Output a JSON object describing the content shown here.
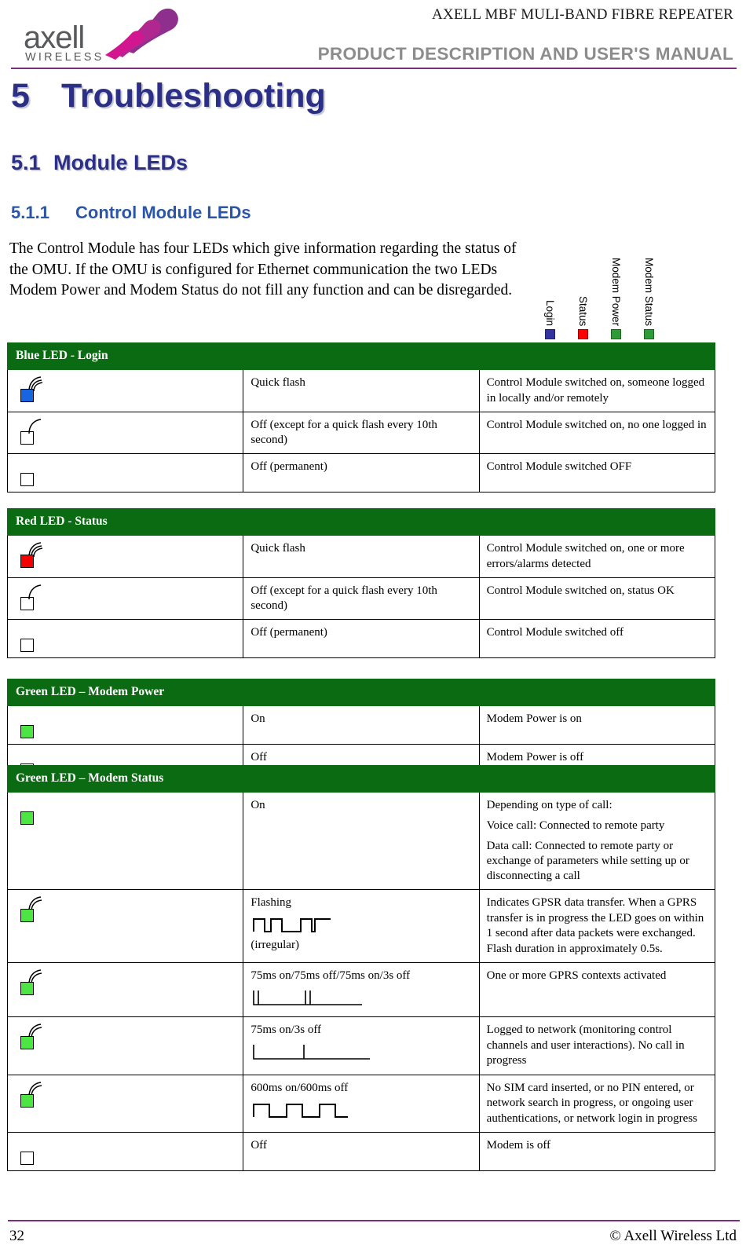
{
  "header": {
    "line1": "AXELL MBF MULI-BAND FIBRE REPEATER",
    "line2": "PRODUCT DESCRIPTION AND USER'S MANUAL",
    "logo_word": "axell",
    "logo_sub": "WIRELESS",
    "rule_color": "#7b2d7e"
  },
  "headings": {
    "h1_number": "5",
    "h1_text": "Troubleshooting",
    "h2_number": "5.1",
    "h2_text": "Module LEDs",
    "h3_number": "5.1.1",
    "h3_text": "Control Module LEDs",
    "h1_color": "#2b2f86",
    "h3_color": "#2b56a8"
  },
  "intro": {
    "paragraph": "The Control Module has four LEDs which give information regarding the status of the OMU. If the OMU is configured for Ethernet communication the two LEDs Modem Power and Modem Status do not fill any function and can be disregarded."
  },
  "led_legend": [
    {
      "label": "Login",
      "color": "#3333a0"
    },
    {
      "label": "Status",
      "color": "#fe0000"
    },
    {
      "label": "Modem Power",
      "color": "#2e9b37"
    },
    {
      "label": "Modem Status",
      "color": "#2e9b37"
    }
  ],
  "tables": [
    {
      "title": "Blue LED - Login",
      "header_color": "#0b6b12",
      "rows": [
        {
          "icon": {
            "state": "on",
            "color": "blue",
            "arcs": 3
          },
          "description": [
            "Quick flash"
          ],
          "meaning": [
            "Control Module switched on, someone logged in locally and/or remotely"
          ]
        },
        {
          "icon": {
            "state": "off",
            "color": "blue",
            "arcs": 1
          },
          "description": [
            "Off (except for a quick flash every 10th second)"
          ],
          "meaning": [
            "Control Module switched on, no one logged in"
          ]
        },
        {
          "icon": {
            "state": "off",
            "color": "blue",
            "arcs": 0
          },
          "description": [
            "Off  (permanent)"
          ],
          "meaning": [
            "Control Module switched OFF"
          ]
        }
      ]
    },
    {
      "title": "Red LED - Status",
      "header_color": "#0b6b12",
      "rows": [
        {
          "icon": {
            "state": "on",
            "color": "red",
            "arcs": 3
          },
          "description": [
            "Quick flash"
          ],
          "meaning": [
            "Control Module switched on, one or more errors/alarms detected"
          ]
        },
        {
          "icon": {
            "state": "off",
            "color": "red",
            "arcs": 1
          },
          "description": [
            "Off (except for a quick flash every 10th second)"
          ],
          "meaning": [
            "Control Module switched on, status OK"
          ]
        },
        {
          "icon": {
            "state": "off",
            "color": "red",
            "arcs": 0
          },
          "description": [
            "Off  (permanent)"
          ],
          "meaning": [
            "Control Module switched off"
          ]
        }
      ]
    },
    {
      "title": "Green LED – Modem Power",
      "header_color": "#0b6b12",
      "rows": [
        {
          "icon": {
            "state": "on",
            "color": "green",
            "arcs": 0
          },
          "description": [
            "On"
          ],
          "meaning": [
            "Modem Power is on"
          ]
        },
        {
          "icon": {
            "state": "off",
            "color": "green",
            "arcs": 0
          },
          "description": [
            "Off"
          ],
          "meaning": [
            "Modem Power is off"
          ]
        }
      ]
    },
    {
      "title": "Green LED – Modem Status",
      "header_color": "#0b6b12",
      "rows": [
        {
          "icon": {
            "state": "on",
            "color": "green",
            "arcs": 0
          },
          "description": [
            "On"
          ],
          "meaning": [
            "Depending on type of call:",
            "Voice call: Connected to remote party",
            "Data call: Connected to remote party or exchange of parameters while setting up or disconnecting a call"
          ]
        },
        {
          "icon": {
            "state": "on",
            "color": "green",
            "arcs": 2
          },
          "description": [
            "Flashing",
            "(irregular)"
          ],
          "waveform": "irregular",
          "meaning": [
            "Indicates GPSR data transfer. When a GPRS transfer is in progress the LED goes on within 1 second after data packets were exchanged. Flash duration in approximately 0.5s."
          ]
        },
        {
          "icon": {
            "state": "on",
            "color": "green",
            "arcs": 2
          },
          "description": [
            "75ms on/75ms off/75ms on/3s off"
          ],
          "waveform": "double-pulse",
          "meaning": [
            "One or more GPRS contexts activated"
          ]
        },
        {
          "icon": {
            "state": "on",
            "color": "green",
            "arcs": 2
          },
          "description": [
            "75ms on/3s off"
          ],
          "waveform": "single-pulse",
          "meaning": [
            "Logged to network (monitoring control channels and user interactions). No call in progress"
          ]
        },
        {
          "icon": {
            "state": "on",
            "color": "green",
            "arcs": 2
          },
          "description": [
            "600ms on/600ms off"
          ],
          "waveform": "square",
          "meaning": [
            "No SIM card inserted, or no PIN entered, or network search in progress, or ongoing user authentications, or network login in progress"
          ]
        },
        {
          "icon": {
            "state": "off",
            "color": "green",
            "arcs": 0
          },
          "description": [
            "Off"
          ],
          "meaning": [
            "Modem is off"
          ]
        }
      ]
    }
  ],
  "footer": {
    "page_number": "32",
    "copyright": "© Axell Wireless Ltd",
    "rule_color": "#7b2d7e"
  }
}
